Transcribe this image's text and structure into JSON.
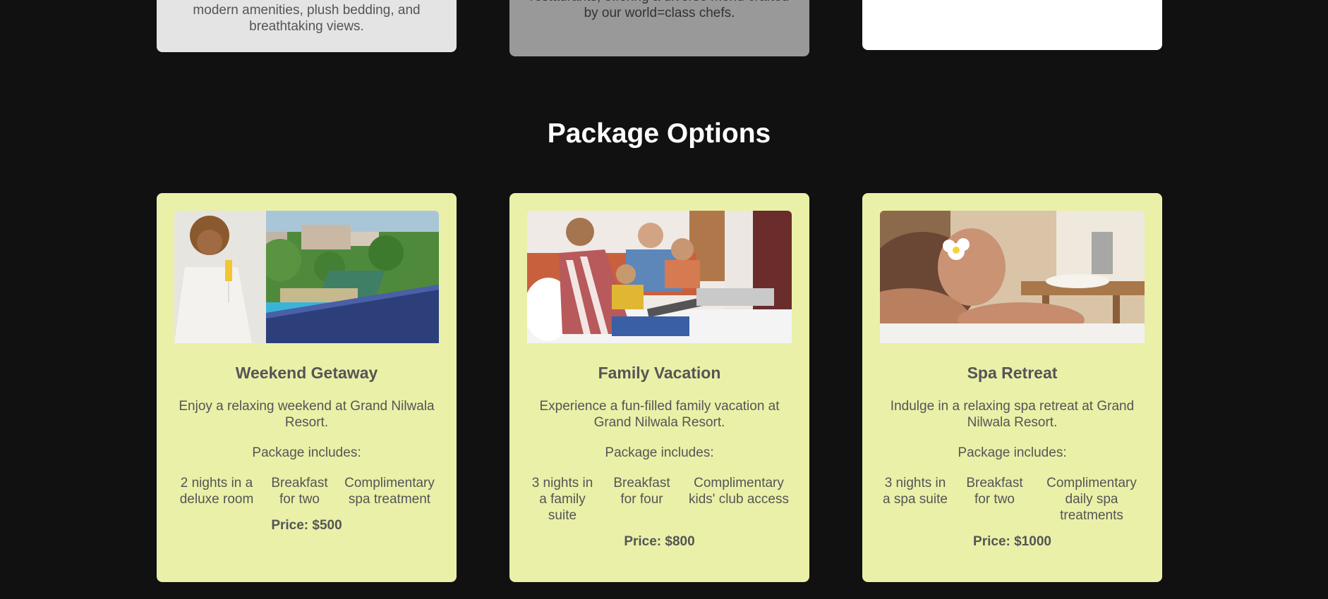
{
  "features_top": [
    {
      "text": "modern amenities, plush bedding, and breathtaking views."
    },
    {
      "text": "restaurants, offering a diverse menu crafted by our world=class chefs."
    },
    {
      "text": ""
    }
  ],
  "section": {
    "title": "Package Options"
  },
  "packages": [
    {
      "title": "Weekend Getaway",
      "description": "Enjoy a relaxing weekend at Grand Nilwala Resort.",
      "includes_label": "Package includes:",
      "includes": [
        "2 nights in a deluxe room",
        "Breakfast for two",
        "Complimentary spa treatment"
      ],
      "price": "Price: $500",
      "image": "woman-on-balcony-photo"
    },
    {
      "title": "Family Vacation",
      "description": "Experience a fun-filled family vacation at Grand Nilwala Resort.",
      "includes_label": "Package includes:",
      "includes": [
        "3 nights in a family suite",
        "Breakfast for four",
        "Complimentary kids' club access"
      ],
      "price": "Price: $800",
      "image": "family-reading-photo"
    },
    {
      "title": "Spa Retreat",
      "description": "Indulge in a relaxing spa retreat at Grand Nilwala Resort.",
      "includes_label": "Package includes:",
      "includes": [
        "3 nights in a spa suite",
        "Breakfast for two",
        "Complimentary daily spa treatments"
      ],
      "price": "Price: $1000",
      "image": "spa-massage-photo"
    }
  ],
  "colors": {
    "background": "#111111",
    "card": "#eaf0a8",
    "text": "#555555",
    "title": "#ffffff"
  }
}
